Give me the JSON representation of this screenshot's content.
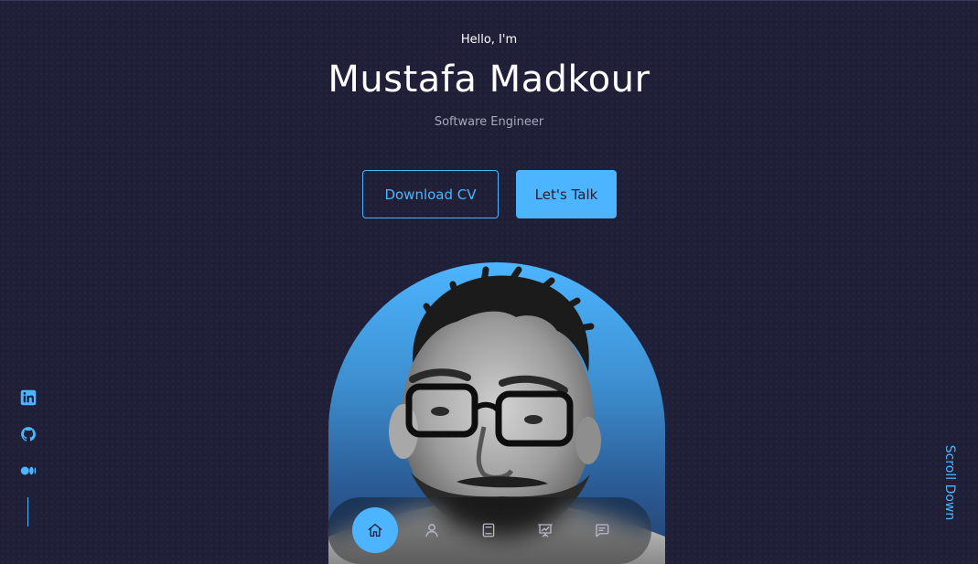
{
  "header": {
    "greeting": "Hello, I'm",
    "name": "Mustafa Madkour",
    "role": "Software Engineer"
  },
  "buttons": {
    "download_cv": "Download CV",
    "lets_talk": "Let's Talk"
  },
  "socials": [
    {
      "icon": "linkedin-icon"
    },
    {
      "icon": "github-icon"
    },
    {
      "icon": "medium-icon"
    }
  ],
  "scroll": {
    "label": "Scroll Down"
  },
  "nav": {
    "items": [
      {
        "icon": "home-icon",
        "active": true
      },
      {
        "icon": "user-icon",
        "active": false
      },
      {
        "icon": "book-icon",
        "active": false
      },
      {
        "icon": "presentation-icon",
        "active": false
      },
      {
        "icon": "message-icon",
        "active": false
      }
    ]
  },
  "colors": {
    "background": "#1f1f38",
    "accent": "#4db5ff",
    "muted_text": "#a8a8bd"
  }
}
